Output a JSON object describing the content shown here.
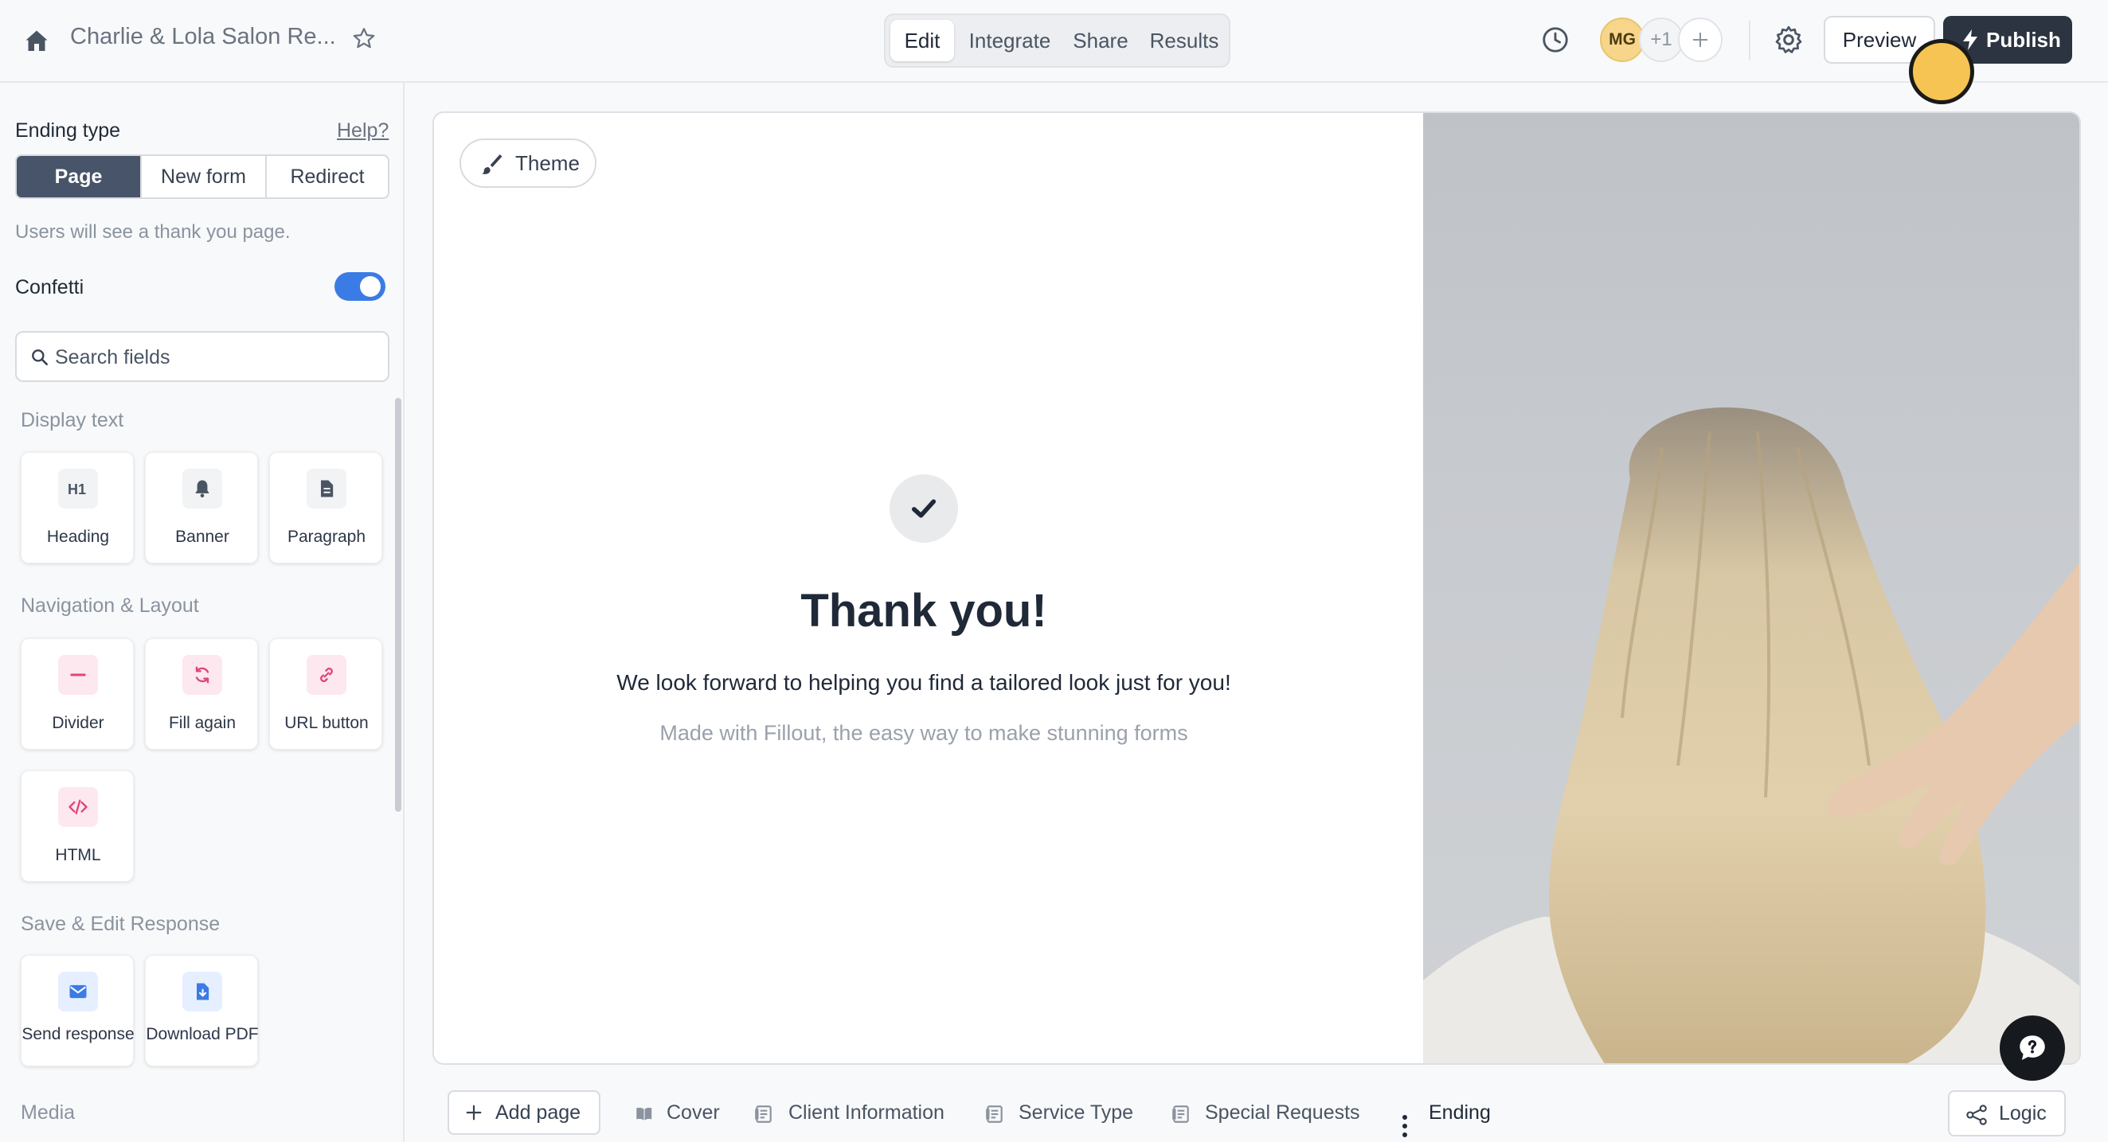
{
  "topbar": {
    "form_title": "Charlie & Lola Salon Re...",
    "tabs": [
      {
        "label": "Edit",
        "active": true
      },
      {
        "label": "Integrate",
        "active": false
      },
      {
        "label": "Share",
        "active": false
      },
      {
        "label": "Results",
        "active": false
      }
    ],
    "collaborators": {
      "initials": "MG",
      "more": "+1"
    },
    "preview_label": "Preview",
    "publish_label": "Publish"
  },
  "left_panel": {
    "ending_type_label": "Ending type",
    "help_label": "Help?",
    "ending_options": [
      {
        "label": "Page",
        "selected": true
      },
      {
        "label": "New form",
        "selected": false
      },
      {
        "label": "Redirect",
        "selected": false
      }
    ],
    "helper_text": "Users will see a thank you page.",
    "confetti_label": "Confetti",
    "confetti_on": true,
    "search_placeholder": "Search fields",
    "sections": [
      {
        "title": "Display text",
        "items": [
          {
            "label": "Heading",
            "icon": "heading-icon"
          },
          {
            "label": "Banner",
            "icon": "bell-icon"
          },
          {
            "label": "Paragraph",
            "icon": "document-icon"
          }
        ]
      },
      {
        "title": "Navigation & Layout",
        "items": [
          {
            "label": "Divider",
            "icon": "divider-icon"
          },
          {
            "label": "Fill again",
            "icon": "refresh-icon"
          },
          {
            "label": "URL button",
            "icon": "link-icon"
          },
          {
            "label": "HTML",
            "icon": "code-icon"
          }
        ]
      },
      {
        "title": "Save & Edit Response",
        "items": [
          {
            "label": "Send response",
            "icon": "mail-icon"
          },
          {
            "label": "Download PDF",
            "icon": "download-icon"
          }
        ]
      },
      {
        "title": "Media",
        "items": []
      }
    ]
  },
  "canvas": {
    "theme_label": "Theme",
    "title": "Thank you!",
    "message": "We look forward to helping you find a tailored look just for you!",
    "credit": "Made with Fillout, the easy way to make stunning forms"
  },
  "bottom_bar": {
    "add_page_label": "Add page",
    "pages": [
      {
        "label": "Cover",
        "icon": "book-icon"
      },
      {
        "label": "Client Information",
        "icon": "form-page-icon"
      },
      {
        "label": "Service Type",
        "icon": "form-page-icon"
      },
      {
        "label": "Special Requests",
        "icon": "form-page-icon"
      },
      {
        "label": "Ending",
        "icon": "kebab-icon"
      }
    ],
    "logic_label": "Logic"
  },
  "colors": {
    "accent": "#3b7be5",
    "publish_bg": "#2b3440",
    "selected_segment": "#475469",
    "pink_icon": "#e0457b",
    "blue_icon": "#3b7be5"
  }
}
